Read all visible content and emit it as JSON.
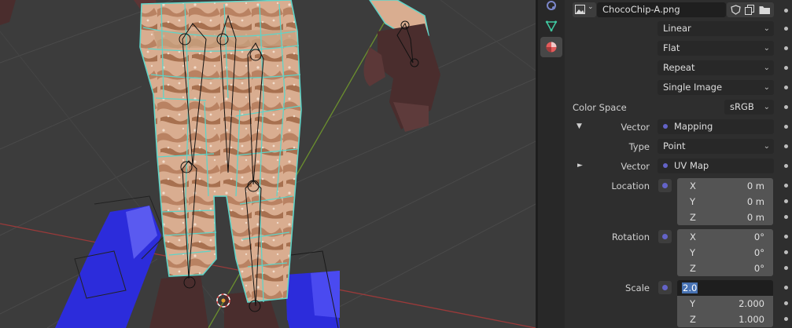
{
  "viewport": {
    "description_colors": {
      "background": "#3c3c3c",
      "wire": "#5fd4c8",
      "skin": "#d8a88a",
      "boots": "#2b2bd9",
      "hands": "#4a2d2d"
    }
  },
  "tabs": [
    {
      "name": "constraint-tab",
      "icon": "object-constraint-icon"
    },
    {
      "name": "data-tab",
      "icon": "object-data-icon"
    },
    {
      "name": "material-tab",
      "icon": "material-icon",
      "active": true
    }
  ],
  "image_block": {
    "image_name": "ChocoChip-A.png",
    "interpolation": "Linear",
    "projection": "Flat",
    "extension": "Repeat",
    "source": "Single Image",
    "color_space_label": "Color Space",
    "color_space": "sRGB"
  },
  "vector_mapping": {
    "label": "Vector",
    "value": "Mapping",
    "type_label": "Type",
    "type_value": "Point"
  },
  "vector_uv": {
    "label": "Vector",
    "value": "UV Map"
  },
  "location": {
    "label": "Location",
    "x_label": "X",
    "x": "0 m",
    "y_label": "Y",
    "y": "0 m",
    "z_label": "Z",
    "z": "0 m"
  },
  "rotation": {
    "label": "Rotation",
    "x_label": "X",
    "x": "0°",
    "y_label": "Y",
    "y": "0°",
    "z_label": "Z",
    "z": "0°"
  },
  "scale": {
    "label": "Scale",
    "x": "2.0",
    "y_label": "Y",
    "y": "2.000",
    "z_label": "Z",
    "z": "1.000"
  }
}
